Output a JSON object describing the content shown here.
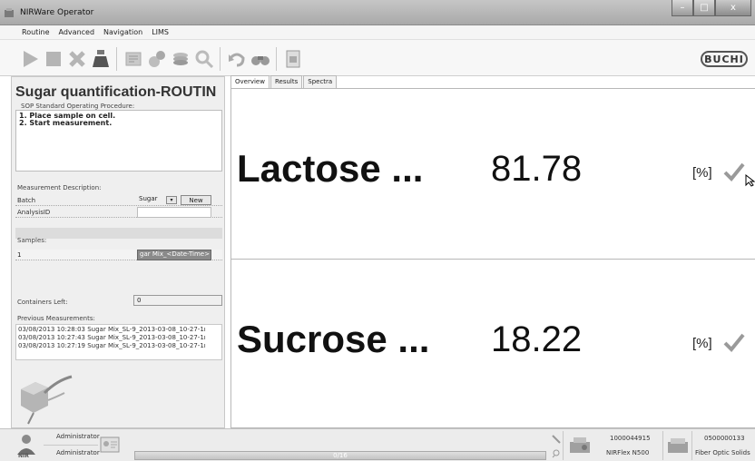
{
  "window": {
    "title": "NIRWare Operator",
    "buttons": [
      "–",
      "□",
      "x"
    ]
  },
  "menu": [
    "Routine",
    "Advanced",
    "Navigation",
    "LIMS"
  ],
  "toolbar": {
    "logo_text": "BUCHI"
  },
  "left_panel": {
    "method_title": "Sugar quantification-ROUTIN",
    "sop_label": "SOP Standard Operating Procedure:",
    "sop_lines": [
      "1. Place sample on cell.",
      "2. Start measurement."
    ],
    "measurement_description_label": "Measurement Description:",
    "batch_label": "Batch",
    "batch_value": "Sugar",
    "new_button": "New",
    "analysis_id_label": "AnalysisID",
    "samples_label": "Samples:",
    "sample_index": "1",
    "sample_name": "gar Mix_<Date-Time>",
    "containers_left_label": "Containers Left:",
    "containers_left_value": "0",
    "previous_label": "Previous Measurements:",
    "previous": [
      "03/08/2013   10:28:03   Sugar Mix_SL-9_2013-03-08_10-27-1ı",
      "03/08/2013   10:27:43   Sugar Mix_SL-9_2013-03-08_10-27-1ı",
      "03/08/2013   10:27:19   Sugar Mix_SL-9_2013-03-08_10-27-1ı"
    ]
  },
  "tabs": [
    "Overview",
    "Results",
    "Spectra"
  ],
  "results": [
    {
      "name": "Lactose ...",
      "value": "81.78",
      "unit": "[%]"
    },
    {
      "name": "Sucrose ...",
      "value": "18.22",
      "unit": "[%]"
    }
  ],
  "status": {
    "user_line1": "Administrator",
    "user_line2": "Administrator",
    "progress_label": "0/16",
    "progress": 0,
    "instrument1_serial": "1000044915",
    "instrument1_name": "NIRFlex N500",
    "instrument2_serial": "0500000133",
    "instrument2_name": "Fiber Optic Solids"
  }
}
